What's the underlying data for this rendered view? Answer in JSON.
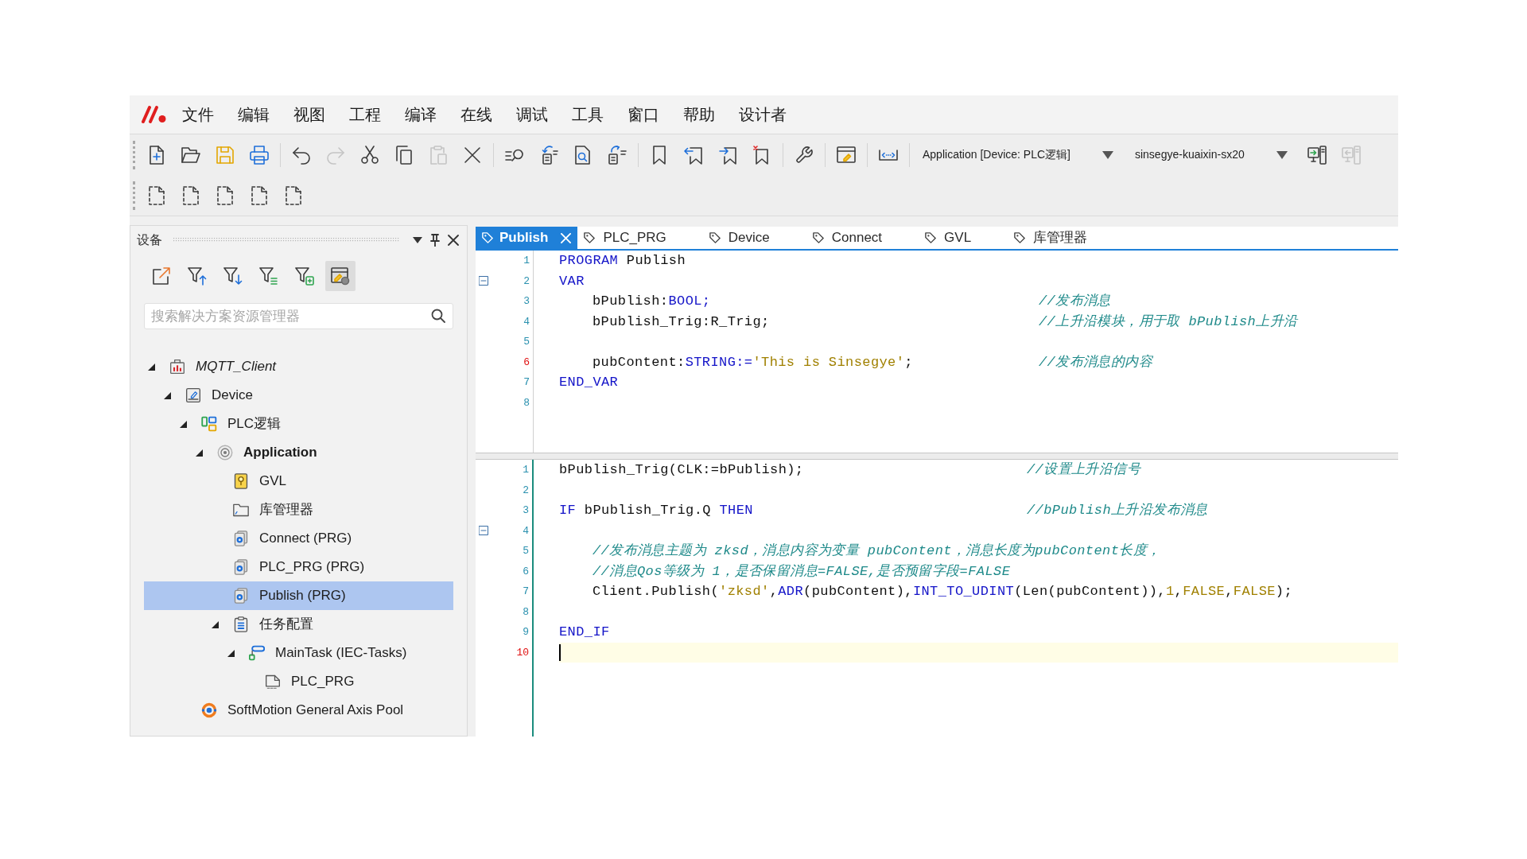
{
  "menu": {
    "items": [
      "文件",
      "编辑",
      "视图",
      "工程",
      "编译",
      "在线",
      "调试",
      "工具",
      "窗口",
      "帮助",
      "设计者"
    ]
  },
  "toolbar": {
    "rows": [
      [
        {
          "kind": "new-file",
          "disabled": false
        },
        {
          "kind": "open",
          "disabled": false
        },
        {
          "kind": "save",
          "disabled": false
        },
        {
          "kind": "print",
          "disabled": false
        },
        {
          "kind": "separator"
        },
        {
          "kind": "undo",
          "disabled": false
        },
        {
          "kind": "redo",
          "disabled": true
        },
        {
          "kind": "cut",
          "disabled": false
        },
        {
          "kind": "copy",
          "disabled": false
        },
        {
          "kind": "paste",
          "disabled": true
        },
        {
          "kind": "delete",
          "disabled": false
        },
        {
          "kind": "separator"
        },
        {
          "kind": "find",
          "disabled": false
        },
        {
          "kind": "replace",
          "disabled": false
        },
        {
          "kind": "find-in-file",
          "disabled": false
        },
        {
          "kind": "replace-all",
          "disabled": false
        },
        {
          "kind": "separator"
        },
        {
          "kind": "bookmark",
          "disabled": false
        },
        {
          "kind": "bookmark-prev",
          "disabled": false
        },
        {
          "kind": "bookmark-next",
          "disabled": false
        },
        {
          "kind": "bookmark-clear",
          "disabled": false
        },
        {
          "kind": "separator"
        },
        {
          "kind": "wrench",
          "disabled": false
        },
        {
          "kind": "separator"
        },
        {
          "kind": "window",
          "disabled": false
        },
        {
          "kind": "separator"
        },
        {
          "kind": "expand",
          "disabled": false
        },
        {
          "kind": "separator"
        },
        {
          "kind": "dropdown",
          "value": "Application [Device: PLC逻辑]"
        },
        {
          "kind": "dropdown",
          "value": "sinsegye-kuaixin-sx20"
        },
        {
          "kind": "login",
          "disabled": false
        },
        {
          "kind": "logout",
          "disabled": true
        }
      ],
      [
        {
          "kind": "dashed-file",
          "disabled": false
        },
        {
          "kind": "dashed-file",
          "disabled": false
        },
        {
          "kind": "dashed-file",
          "disabled": false
        },
        {
          "kind": "dashed-file",
          "disabled": false
        },
        {
          "kind": "dashed-file",
          "disabled": false
        }
      ]
    ]
  },
  "explorer": {
    "title": "设备",
    "tools": [
      {
        "kind": "export",
        "pressed": false
      },
      {
        "kind": "filter-up",
        "pressed": false
      },
      {
        "kind": "filter-down",
        "pressed": false
      },
      {
        "kind": "filter-lines",
        "pressed": false
      },
      {
        "kind": "filter-square",
        "pressed": false
      },
      {
        "kind": "window",
        "pressed": true
      }
    ],
    "search": {
      "placeholder": "搜索解决方案资源管理器"
    },
    "tree": [
      {
        "label": "MQTT_Client",
        "kind": "project",
        "italic": true,
        "bold": false,
        "expanded": true,
        "selected": false,
        "children": [
          {
            "label": "Device",
            "kind": "device",
            "italic": false,
            "bold": false,
            "expanded": true,
            "selected": false,
            "children": [
              {
                "label": "PLC逻辑",
                "kind": "plc-logic",
                "italic": false,
                "bold": false,
                "expanded": true,
                "selected": false,
                "children": [
                  {
                    "label": "Application",
                    "kind": "application",
                    "italic": false,
                    "bold": true,
                    "expanded": true,
                    "selected": false,
                    "children": [
                      {
                        "label": "GVL",
                        "kind": "gvl",
                        "italic": false,
                        "bold": false,
                        "selected": false
                      },
                      {
                        "label": "库管理器",
                        "kind": "library",
                        "italic": false,
                        "bold": false,
                        "selected": false
                      },
                      {
                        "label": "Connect (PRG)",
                        "kind": "pou",
                        "italic": false,
                        "bold": false,
                        "selected": false
                      },
                      {
                        "label": "PLC_PRG (PRG)",
                        "kind": "pou",
                        "italic": false,
                        "bold": false,
                        "selected": false
                      },
                      {
                        "label": "Publish (PRG)",
                        "kind": "pou",
                        "italic": false,
                        "bold": false,
                        "selected": true
                      },
                      {
                        "label": "任务配置",
                        "kind": "task-config",
                        "italic": false,
                        "bold": false,
                        "expanded": true,
                        "selected": false,
                        "children": [
                          {
                            "label": "MainTask (IEC-Tasks)",
                            "kind": "task",
                            "italic": false,
                            "bold": false,
                            "expanded": true,
                            "selected": false,
                            "children": [
                              {
                                "label": "PLC_PRG",
                                "kind": "task-call",
                                "italic": false,
                                "bold": false,
                                "selected": false
                              }
                            ]
                          }
                        ]
                      }
                    ]
                  }
                ]
              },
              {
                "label": "SoftMotion General Axis Pool",
                "kind": "axis-pool",
                "italic": false,
                "bold": false,
                "selected": false
              }
            ]
          }
        ]
      }
    ]
  },
  "editor": {
    "tabs": [
      {
        "label": "Publish",
        "selected": true
      },
      {
        "label": "PLC_PRG",
        "selected": false
      },
      {
        "label": "Device",
        "selected": false
      },
      {
        "label": "Connect",
        "selected": false
      },
      {
        "label": "GVL",
        "selected": false
      },
      {
        "label": "库管理器",
        "selected": false
      }
    ],
    "panes": [
      {
        "focused": false,
        "lines": [
          {
            "number": "1",
            "marked": false,
            "fold": false,
            "current": false,
            "tokens": [
              {
                "kind": "keyword",
                "text": "PROGRAM"
              },
              {
                "kind": "plain",
                "text": " Publish"
              }
            ]
          },
          {
            "number": "2",
            "marked": false,
            "fold": true,
            "current": false,
            "tokens": [
              {
                "kind": "keyword",
                "text": "VAR"
              }
            ],
            "children": [
              {
                "number": "3",
                "marked": false,
                "fold": false,
                "current": false,
                "tokens": [
                  {
                    "kind": "plain",
                    "text": "bPublish:"
                  },
                  {
                    "kind": "keyword",
                    "text": "BOOL;"
                  }
                ],
                "comment": "//发布消息"
              },
              {
                "number": "4",
                "marked": false,
                "fold": false,
                "current": false,
                "tokens": [
                  {
                    "kind": "plain",
                    "text": "bPublish_Trig:R_Trig;"
                  }
                ],
                "comment": "//上升沿模块，用于取 bPublish上升沿"
              },
              {
                "number": "5",
                "marked": false,
                "fold": false,
                "current": false
              },
              {
                "number": "6",
                "marked": true,
                "fold": false,
                "current": false,
                "tokens": [
                  {
                    "kind": "plain",
                    "text": "pubContent:"
                  },
                  {
                    "kind": "keyword",
                    "text": "STRING:="
                  },
                  {
                    "kind": "string",
                    "text": "'This is Sinsegye'"
                  },
                  {
                    "kind": "plain",
                    "text": ";"
                  }
                ],
                "comment": "//发布消息的内容"
              }
            ]
          },
          {
            "number": "7",
            "marked": false,
            "fold": false,
            "current": false,
            "tokens": [
              {
                "kind": "keyword",
                "text": "END_VAR"
              }
            ]
          },
          {
            "number": "8",
            "marked": false,
            "fold": false,
            "current": false
          }
        ]
      },
      {
        "focused": true,
        "lines": [
          {
            "number": "1",
            "marked": false,
            "fold": false,
            "current": false,
            "tokens": [
              {
                "kind": "plain",
                "text": "bPublish_Trig(CLK:=bPublish);"
              }
            ],
            "comment": "//设置上升沿信号"
          },
          {
            "number": "2",
            "marked": false,
            "fold": false,
            "current": false
          },
          {
            "number": "3",
            "marked": false,
            "fold": false,
            "current": false,
            "tokens": [
              {
                "kind": "keyword",
                "text": "IF"
              },
              {
                "kind": "plain",
                "text": " bPublish_Trig.Q "
              },
              {
                "kind": "keyword",
                "text": "THEN"
              }
            ],
            "comment": "//bPublish上升沿发布消息",
            "children": [
              {
                "number": "4",
                "marked": false,
                "fold": true,
                "current": false
              },
              {
                "number": "5",
                "marked": false,
                "fold": false,
                "current": false,
                "tokens": [
                  {
                    "kind": "comment",
                    "text": "//发布消息主题为 zksd，消息内容为变量 pubContent，消息长度为pubContent长度，"
                  }
                ]
              },
              {
                "number": "6",
                "marked": false,
                "fold": false,
                "current": false,
                "tokens": [
                  {
                    "kind": "comment",
                    "text": "//消息Qos等级为 1，是否保留消息=FALSE,是否预留字段=FALSE"
                  }
                ]
              },
              {
                "number": "7",
                "marked": false,
                "fold": false,
                "current": false,
                "tokens": [
                  {
                    "kind": "plain",
                    "text": "Client.Publish("
                  },
                  {
                    "kind": "string",
                    "text": "'zksd'"
                  },
                  {
                    "kind": "plain",
                    "text": ","
                  },
                  {
                    "kind": "keyword",
                    "text": "ADR"
                  },
                  {
                    "kind": "plain",
                    "text": "(pubContent),"
                  },
                  {
                    "kind": "keyword",
                    "text": "INT_TO_UDINT"
                  },
                  {
                    "kind": "plain",
                    "text": "(Len(pubContent)),"
                  },
                  {
                    "kind": "literal",
                    "text": "1"
                  },
                  {
                    "kind": "plain",
                    "text": ","
                  },
                  {
                    "kind": "literal",
                    "text": "FALSE"
                  },
                  {
                    "kind": "plain",
                    "text": ","
                  },
                  {
                    "kind": "literal",
                    "text": "FALSE"
                  },
                  {
                    "kind": "plain",
                    "text": ");"
                  }
                ]
              },
              {
                "number": "8",
                "marked": false,
                "fold": false,
                "current": false
              }
            ]
          },
          {
            "number": "9",
            "marked": false,
            "fold": false,
            "current": false,
            "tokens": [
              {
                "kind": "keyword",
                "text": "END_IF"
              }
            ]
          },
          {
            "number": "10",
            "marked": true,
            "fold": false,
            "current": true
          }
        ]
      }
    ]
  }
}
